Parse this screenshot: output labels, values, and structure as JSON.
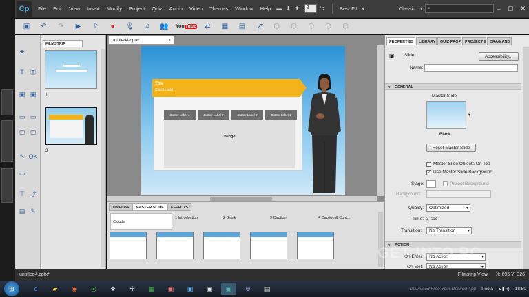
{
  "app": {
    "logo_text": "Cp",
    "menu": [
      "File",
      "Edit",
      "View",
      "Insert",
      "Modify",
      "Project",
      "Quiz",
      "Audio",
      "Video",
      "Themes",
      "Window",
      "Help"
    ],
    "current_slide": "2",
    "slide_total": "/ 2",
    "zoom": "Best Fit",
    "workspace": "Classic",
    "search_placeholder": ""
  },
  "toolbar": {
    "youtube_you": "You",
    "youtube_tube": "Tube"
  },
  "filmstrip": {
    "tab_label": "FILMSTRIP",
    "slides": [
      {
        "num": "1"
      },
      {
        "num": "2"
      }
    ]
  },
  "stage": {
    "doc_tab": "untitled4.cptx*",
    "slide_title": "Title",
    "slide_subtitle": "Click to add",
    "buttons": [
      "Button Label 1",
      "Button Label 2",
      "Button Label 3",
      "Button Label 4"
    ],
    "widget_label": "Widget"
  },
  "bottom_panel": {
    "tabs": [
      "TIMELINE",
      "MASTER SLIDE",
      "EFFECTS"
    ],
    "active_tab": "MASTER SLIDE",
    "first_cell": "Clouds",
    "columns": [
      "1 Introduction",
      "2 Blank",
      "3 Caption",
      "4 Caption & Cont..."
    ]
  },
  "properties": {
    "tabs": [
      "PROPERTIES",
      "LIBRARY",
      "QUIZ PROP",
      "PROJECT IN",
      "DRAG AND"
    ],
    "object_type": "Slide",
    "accessibility_button": "Accessibility...",
    "name_label": "Name:",
    "name_value": "",
    "general_header": "GENERAL",
    "master_slide_label": "Master Slide",
    "master_slide_name": "Blank",
    "reset_master_button": "Reset Master Slide",
    "objects_on_top_label": "Master Slide Objects On Top",
    "objects_on_top_checked": false,
    "use_bg_label": "Use Master Slide Background",
    "use_bg_checked": true,
    "stage_label": "Stage:",
    "project_bg_label": "Project Background",
    "background_label": "Background:",
    "quality_label": "Quality:",
    "quality_value": "Optimized",
    "time_label": "Time:",
    "time_value": "3",
    "time_unit": "sec",
    "transition_label": "Transition:",
    "transition_value": "No Transition",
    "action_header": "ACTION",
    "on_enter_label": "On Enter:",
    "on_enter_value": "No Action",
    "on_exit_label": "On Exit:",
    "on_exit_value": "No Action"
  },
  "status_bar": {
    "file": "untitled4.cptx*",
    "view": "Filmstrip View",
    "coords": "X: 695 Y: 326"
  },
  "taskbar": {
    "user": "Pooja",
    "time": "18:50"
  },
  "watermark": {
    "main": "GET INTO PC",
    "sub": "Download Free Your Desired App"
  },
  "colors": {
    "accent_blue": "#2e5f9c",
    "banner_yellow": "#f2b21a",
    "youtube_red": "#dd1111"
  }
}
